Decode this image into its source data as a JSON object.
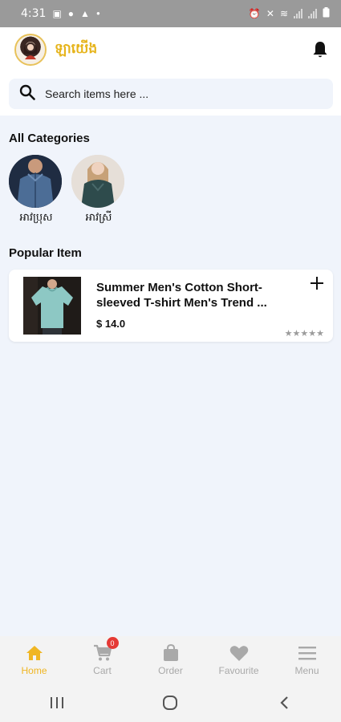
{
  "status_bar": {
    "time": "4:31",
    "left_icons": [
      "image-icon",
      "messenger-icon",
      "warning-icon",
      "dot-icon"
    ],
    "right_icons": [
      "alarm-icon",
      "mute-icon",
      "wifi-icon",
      "signal-icon",
      "signal-icon",
      "battery-icon"
    ]
  },
  "header": {
    "brand": "ឡាយើង",
    "logo_icon": "shop-logo-icon",
    "notification_icon": "bell-icon"
  },
  "search": {
    "placeholder": "Search items here ..."
  },
  "categories": {
    "title": "All Categories",
    "items": [
      {
        "label": "អាវប្រុស",
        "icon": "men-shirt-thumbnail"
      },
      {
        "label": "អាវស្រី",
        "icon": "women-shirt-thumbnail"
      }
    ]
  },
  "popular": {
    "title": "Popular Item",
    "items": [
      {
        "name": "Summer Men's Cotton Short-sleeved T-shirt Men's Trend ...",
        "price": "$ 14.0",
        "rating": 0,
        "rating_max": 5
      }
    ]
  },
  "bottom_nav": {
    "items": [
      {
        "label": "Home",
        "icon": "home-icon",
        "active": true
      },
      {
        "label": "Cart",
        "icon": "cart-icon",
        "active": false,
        "badge": "0"
      },
      {
        "label": "Order",
        "icon": "bag-icon",
        "active": false
      },
      {
        "label": "Favourite",
        "icon": "heart-icon",
        "active": false
      },
      {
        "label": "Menu",
        "icon": "menu-icon",
        "active": false
      }
    ]
  },
  "system_nav": [
    "recents-icon",
    "home-circle-icon",
    "back-icon"
  ],
  "colors": {
    "accent": "#f0b623",
    "background": "#f0f4fb",
    "badge": "#e53935",
    "inactive": "#a9a9a9"
  }
}
